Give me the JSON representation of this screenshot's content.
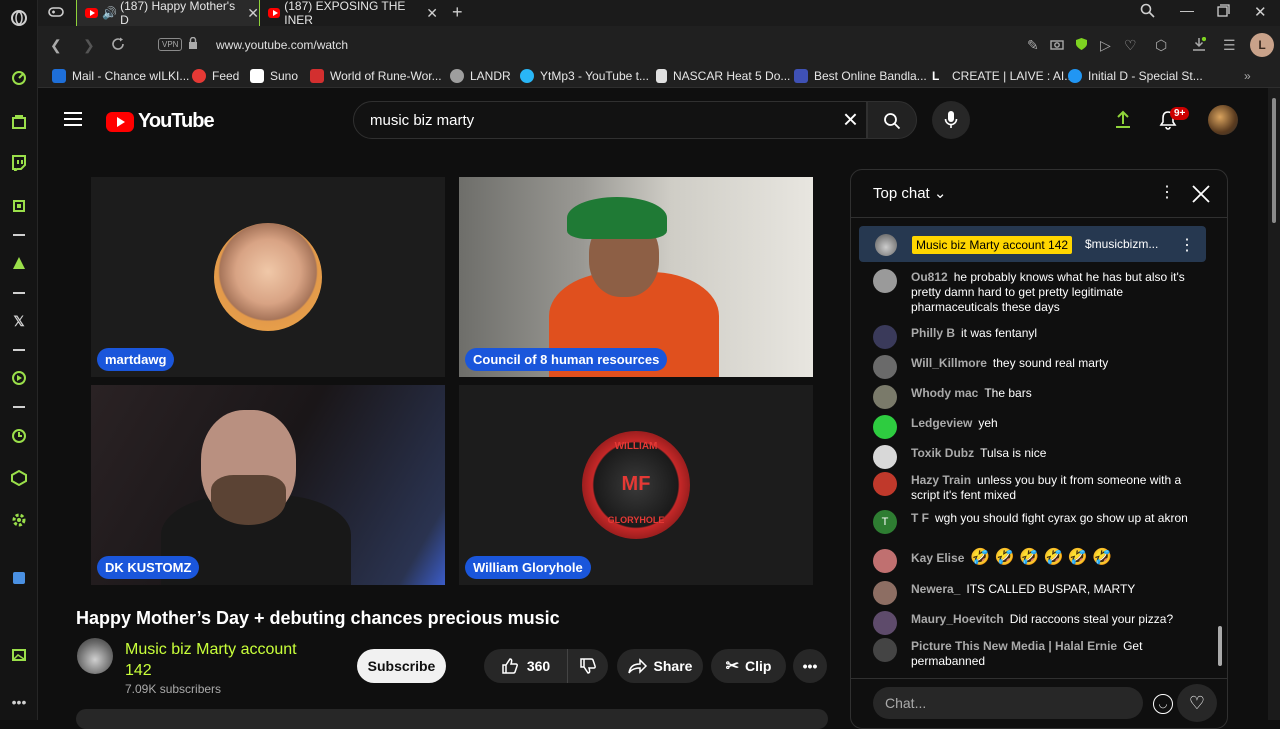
{
  "browser": {
    "tabs": [
      {
        "title": "(187) Happy Mother's D",
        "active": true
      },
      {
        "title": "(187) EXPOSING THE INER",
        "active": false
      }
    ],
    "url": "www.youtube.com/watch",
    "vpn_label": "VPN",
    "bookmarks": [
      {
        "label": "Mail - Chance wILKI...",
        "color": "#1e6fd9"
      },
      {
        "label": "Feed",
        "color": "#e53935"
      },
      {
        "label": "Suno",
        "color": "#ffffff"
      },
      {
        "label": "World of Rune-Wor...",
        "color": "#d32f2f"
      },
      {
        "label": "LANDR",
        "color": "#9e9e9e"
      },
      {
        "label": "YtMp3 - YouTube t...",
        "color": "#29b6f6"
      },
      {
        "label": "NASCAR Heat 5 Do...",
        "color": "#e0e0e0"
      },
      {
        "label": "Best Online Bandla...",
        "color": "#3f51b5"
      },
      {
        "label": "CREATE | LAIVE : AI...",
        "color": "#ffffff"
      },
      {
        "label": "Initial D - Special St...",
        "color": "#2196f3"
      }
    ],
    "profile_initial": "L"
  },
  "youtube": {
    "logo_text": "YouTube",
    "search_value": "music biz marty",
    "notifications_badge": "9+"
  },
  "video": {
    "participants": [
      {
        "name": "martdawg"
      },
      {
        "name": "Council of 8 human resources"
      },
      {
        "name": "DK KUSTOMZ"
      },
      {
        "name": "William Gloryhole"
      }
    ],
    "logo_text_top": "WILLIAM",
    "logo_text_mid": "MF",
    "logo_text_bottom": "GLORYHOLE",
    "title": "Happy Mother’s Day + debuting chances precious music",
    "channel": {
      "name": "Music biz Marty account 142",
      "subscribers": "7.09K subscribers"
    },
    "subscribe_label": "Subscribe",
    "likes": "360",
    "share_label": "Share",
    "clip_label": "Clip"
  },
  "chat": {
    "header": "Top chat",
    "pinned": {
      "author": "Music biz Marty account 142",
      "message": "$musicbizm..."
    },
    "messages": [
      {
        "author": "Ou812",
        "text": "he probably knows what he has but also it's pretty damn hard to get pretty legitimate pharmaceuticals these days",
        "color": "#9a9a9a"
      },
      {
        "author": "Philly B",
        "text": "it was fentanyl",
        "color": "#3a3a5a"
      },
      {
        "author": "Will_Killmore",
        "text": "they sound real marty",
        "color": "#6a6a6a"
      },
      {
        "author": "Whody mac",
        "text": "The bars",
        "color": "#7a7a6a"
      },
      {
        "author": "Ledgeview",
        "text": "yeh",
        "color": "#2ecc40"
      },
      {
        "author": "Toxik Dubz",
        "text": "Tulsa is nice",
        "color": "#d8d8d8"
      },
      {
        "author": "Hazy Train",
        "text": "unless you buy it from someone with a script it's fent mixed",
        "color": "#c0392b"
      },
      {
        "author": "T F",
        "text": "wgh you should fight cyrax go show up at akron",
        "color": "#2e7d32"
      },
      {
        "author": "Kay Elise",
        "text": "🤣 🤣 🤣 🤣 🤣 🤣",
        "color": "#c07070"
      },
      {
        "author": "Newera_",
        "text": "ITS CALLED BUSPAR, MARTY",
        "color": "#8d6e63"
      },
      {
        "author": "Maury_Hoevitch",
        "text": "Did raccoons steal your pizza?",
        "color": "#5e4b6b"
      },
      {
        "author": "Picture This New Media | Halal Ernie",
        "text": "Get permabanned",
        "color": "#444444"
      }
    ],
    "input_placeholder": "Chat..."
  }
}
